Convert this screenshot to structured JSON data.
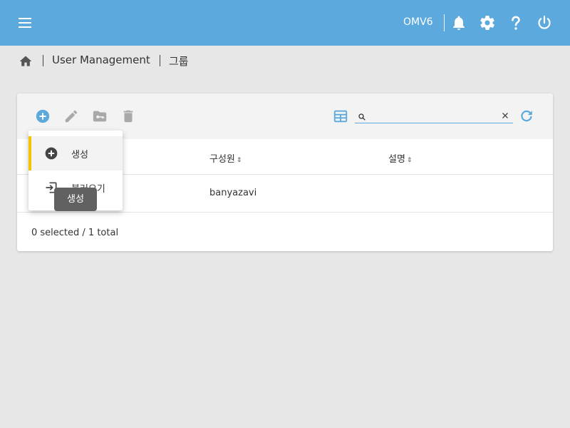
{
  "topbar": {
    "hostname": "OMV6",
    "bg_color": "#5ba9dd",
    "icons": [
      "menu-icon",
      "bell-icon",
      "gear-icon",
      "help-icon",
      "power-icon"
    ]
  },
  "breadcrumb": {
    "items": [
      "User Management",
      "그룹"
    ]
  },
  "toolbar": {
    "icons": [
      "add-circle-icon",
      "edit-icon",
      "folder-key-icon",
      "delete-icon",
      "column-select-icon",
      "refresh-icon"
    ],
    "search_value": "",
    "accent": "#5ba9dd"
  },
  "table": {
    "columns": [
      "구성원",
      "설명"
    ],
    "sort_glyph": "⇕",
    "rows": [
      {
        "members": "banyazavi",
        "description": ""
      }
    ],
    "footer": "0 selected / 1 total"
  },
  "menu": {
    "items": [
      {
        "label": "생성",
        "icon": "add-circle-icon"
      },
      {
        "label": "불러오기",
        "icon": "import-icon"
      }
    ],
    "active_color": "#f5c400"
  },
  "tooltip": "생성"
}
